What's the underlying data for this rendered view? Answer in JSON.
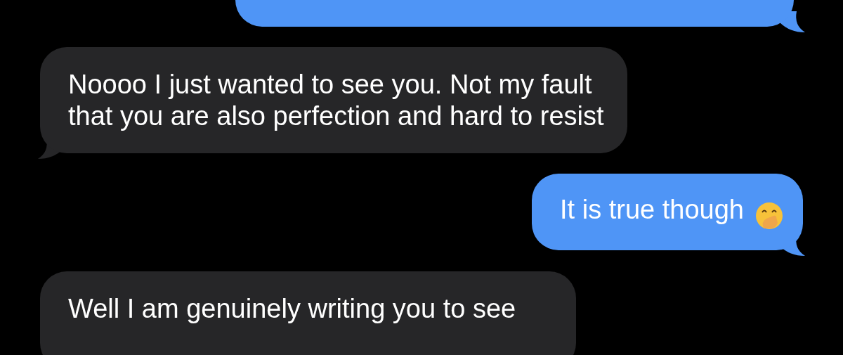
{
  "messages": [
    {
      "kind": "outgoing"
    },
    {
      "kind": "incoming",
      "text": "Noooo I just wanted to see you. Not my fault that you are also perfection and hard to resist"
    },
    {
      "kind": "outgoing",
      "text": "It is true though",
      "emoji": true
    },
    {
      "kind": "incoming",
      "text": "Well I am genuinely writing you to see"
    }
  ]
}
